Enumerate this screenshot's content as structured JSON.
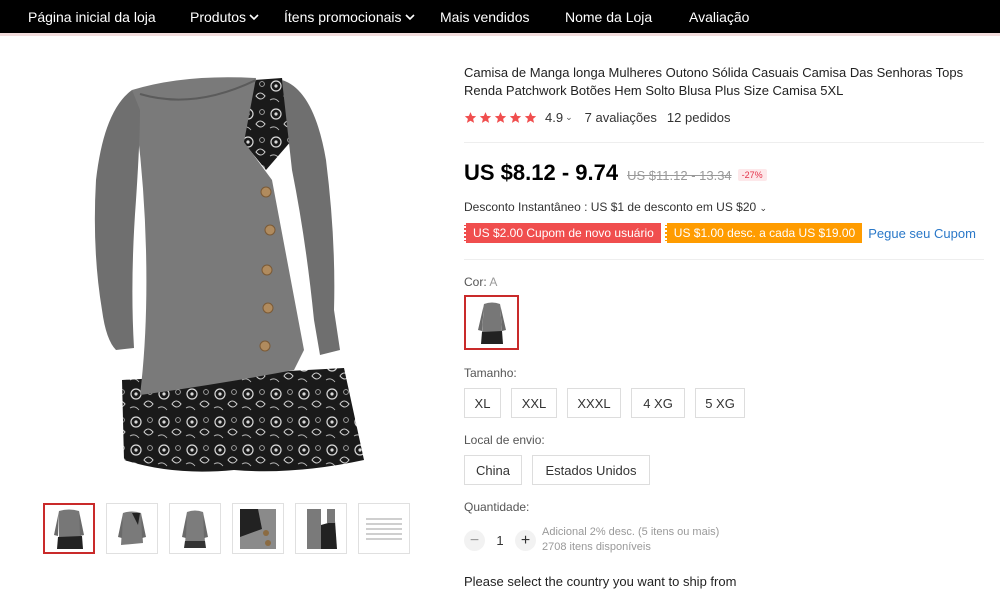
{
  "nav": {
    "items": [
      {
        "label": "Página inicial da loja",
        "has_dropdown": false
      },
      {
        "label": "Produtos",
        "has_dropdown": true
      },
      {
        "label": "Ítens promocionais",
        "has_dropdown": true
      },
      {
        "label": "Mais vendidos",
        "has_dropdown": false
      },
      {
        "label": "Nome da Loja",
        "has_dropdown": false
      },
      {
        "label": "Avaliação",
        "has_dropdown": false
      }
    ]
  },
  "product": {
    "title": "Camisa de Manga longa Mulheres Outono Sólida Casuais Camisa Das Senhoras Tops Renda Patchwork Botões Hem Solto Blusa Plus Size Camisa 5XL",
    "rating": "4.9",
    "stars": 5,
    "reviews": "7 avaliações",
    "orders": "12 pedidos",
    "price": "US $8.12 - 9.74",
    "old_price": "US $11.12 - 13.34",
    "discount": "-27%",
    "instant_discount": "Desconto Instantâneo : US $1 de desconto em US $20",
    "coupons": {
      "new_user": "US $2.00 Cupom de novo usuário",
      "per_purchase": "US $1.00 desc. a cada US $19.00",
      "get_coupon": "Pegue seu Cupom"
    },
    "color": {
      "label": "Cor:",
      "value": "A"
    },
    "size": {
      "label": "Tamanho:",
      "options": [
        "XL",
        "XXL",
        "XXXL",
        "4 XG",
        "5 XG"
      ]
    },
    "ship_from": {
      "label": "Local de envio:",
      "options": [
        "China",
        "Estados Unidos"
      ]
    },
    "quantity": {
      "label": "Quantidade:",
      "value": "1",
      "minus": "−",
      "plus": "+",
      "extra_discount": "Adicional 2% desc. (5 itens ou mais)",
      "available": "2708 itens disponíveis"
    },
    "ship_message": "Please select the country you want to ship from"
  },
  "colors": {
    "accent": "#c92a2a",
    "star": "#f04e4e",
    "coupon_red": "#f04e4e",
    "coupon_orange": "#ff9c00",
    "link": "#2a78c8"
  }
}
